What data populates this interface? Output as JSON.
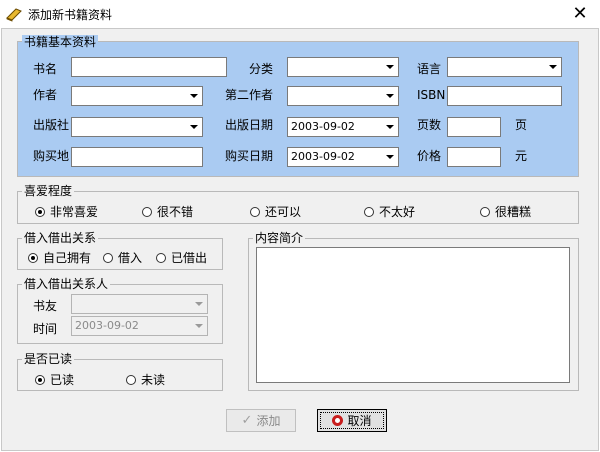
{
  "window": {
    "title": "添加新书籍资料",
    "close_glyph": "✕"
  },
  "basic": {
    "group_title": "书籍基本资料",
    "labels": {
      "title": "书名",
      "category": "分类",
      "language": "语言",
      "author": "作者",
      "second_author": "第二作者",
      "isbn": "ISBN",
      "publisher": "出版社",
      "publish_date": "出版日期",
      "pages": "页数",
      "pages_unit": "页",
      "purchase_place": "购买地",
      "purchase_date": "购买日期",
      "price": "价格",
      "price_unit": "元"
    },
    "values": {
      "title": "",
      "category": "",
      "language": "",
      "author": "",
      "second_author": "",
      "isbn": "",
      "publisher": "",
      "publish_date": "2003-09-02",
      "pages": "",
      "purchase_place": "",
      "purchase_date": "2003-09-02",
      "price": ""
    }
  },
  "preference": {
    "group_title": "喜爱程度",
    "options": [
      "非常喜爱",
      "很不错",
      "还可以",
      "不太好",
      "很糟糕"
    ],
    "selected": "非常喜爱"
  },
  "lending": {
    "group_title": "借入借出关系",
    "options": [
      "自己拥有",
      "借入",
      "已借出"
    ],
    "selected": "自己拥有"
  },
  "lending_person": {
    "group_title": "借入借出关系人",
    "labels": {
      "friend": "书友",
      "time": "时间"
    },
    "values": {
      "friend": "",
      "time": "2003-09-02"
    }
  },
  "read_status": {
    "group_title": "是否已读",
    "options": [
      "已读",
      "未读"
    ],
    "selected": "已读"
  },
  "summary": {
    "group_title": "内容简介",
    "value": ""
  },
  "buttons": {
    "add": "添加",
    "cancel": "取消"
  },
  "colors": {
    "basic_group_bg": "#aacbf2",
    "dialog_bg": "#f0f0f0"
  }
}
